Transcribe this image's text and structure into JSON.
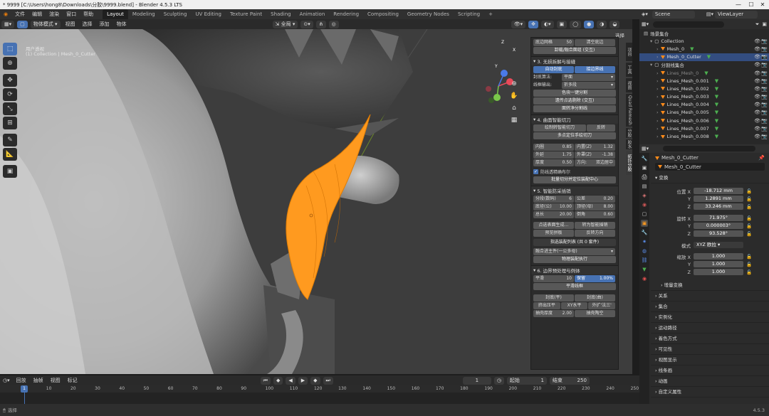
{
  "window": {
    "title": "* 9999 [C:\\Users\\hong8\\Downloads\\分胶\\9999.blend] - Blender 4.5.3 LTS"
  },
  "menu": [
    "文件",
    "编辑",
    "渲染",
    "窗口",
    "帮助"
  ],
  "workspaces": [
    "Layout",
    "Modeling",
    "Sculpting",
    "UV Editing",
    "Texture Paint",
    "Shading",
    "Animation",
    "Rendering",
    "Compositing",
    "Geometry Nodes",
    "Scripting"
  ],
  "add_tab": "+",
  "scene": {
    "label": "Scene",
    "view_layer": "ViewLayer"
  },
  "viewport_header": {
    "mode": "物体模式",
    "items": [
      "视图",
      "选择",
      "添加",
      "物体"
    ],
    "transform_orient": "全局",
    "select_label": "选择"
  },
  "viewport_info": {
    "line1": "用户透视",
    "line2": "(1) Collection | Mesh_0_Cutter"
  },
  "gizmo": {
    "x": "X",
    "y": "Y",
    "z": "Z"
  },
  "side_tabs": [
    "项目",
    "工具",
    "视图",
    "Quad Remesh",
    "分胶",
    "胶水",
    "拓扑分胶"
  ],
  "npanel": {
    "top_row": {
      "label": "底边网格",
      "value": "50",
      "btn": "清空底边"
    },
    "top_btn": "卸载/融合面组 (交互)",
    "s3": {
      "title": "3. 无损拆解与接缝",
      "tab_auto": "自动封底",
      "tab_seam": "接边界线",
      "algo_label": "封底算法:",
      "algo_value": "平面",
      "line_label": "线框输出:",
      "line_value": "折多段",
      "btn1": "色块一键分割",
      "btn2": "遗传点选剔除 (交互)",
      "btn3": "面转净分割线"
    },
    "s4": {
      "title": "4. 曲面智能切刀",
      "btn_a": "绘制转智能切刀",
      "btn_b": "反转",
      "btn_c": "多点定位手绘切刀",
      "f1": {
        "l": "内圈",
        "v": "0.85"
      },
      "f2": {
        "l": "内置(Z)",
        "v": "1.32"
      },
      "f3": {
        "l": "外延",
        "v": "1.75"
      },
      "f4": {
        "l": "外罩(Z)",
        "v": "-1.38"
      },
      "f5": {
        "l": "厚度",
        "v": "0.50"
      },
      "f6": {
        "l": "方向:",
        "v": "双边居中"
      },
      "check": "防线透精确布尔",
      "btn_d": "批量切分并定位装配中心"
    },
    "s5": {
      "title": "5. 智能防采插销",
      "f1": {
        "l": "分段(数码)",
        "v": "6"
      },
      "f2": {
        "l": "公差",
        "v": "0.20"
      },
      "f3": {
        "l": "底径(公)",
        "v": "10.00"
      },
      "f4": {
        "l": "顶径(母)",
        "v": "8.00"
      },
      "f5": {
        "l": "总长",
        "v": "20.00"
      },
      "f6": {
        "l": "倒角",
        "v": "0.60"
      },
      "btn_a": "点选表面生成…",
      "btn_b": "转为智能插销",
      "btn_c": "预览拼板",
      "btn_d": "反转方向",
      "list": "指选装配列表 (共 0 套件)",
      "dropdown": "融合进主件(一公多母)",
      "btn_e": "物理装配执行"
    },
    "s6": {
      "title": "6. 边界预处理与例体",
      "f1": {
        "l": "平滑",
        "v": "10"
      },
      "tab": "保留",
      "pct": "1.00%",
      "btn_a": "平滑线框",
      "opt_a": "封底(平)",
      "opt_b": "封底(曲)",
      "extrude_l": "挤出压平",
      "extrude_v": "XY水平",
      "extrude_r": "外扩'法三'",
      "thick_l": "抽壳厚度",
      "thick_v": "2.00",
      "btn_b": "抽壳陶空"
    }
  },
  "outliner": {
    "root": "场景集合",
    "items": [
      {
        "name": "Collection",
        "indent": 1,
        "type": "coll"
      },
      {
        "name": "Mesh_0",
        "indent": 2,
        "type": "mesh"
      },
      {
        "name": "Mesh_0_Cutter",
        "indent": 2,
        "type": "mesh",
        "selected": true
      },
      {
        "name": "分割线集合",
        "indent": 1,
        "type": "coll"
      },
      {
        "name": "Lines_Mesh_0",
        "indent": 2,
        "type": "mesh",
        "dim": true
      },
      {
        "name": "Lines_Mesh_0.001",
        "indent": 2,
        "type": "mesh"
      },
      {
        "name": "Lines_Mesh_0.002",
        "indent": 2,
        "type": "mesh"
      },
      {
        "name": "Lines_Mesh_0.003",
        "indent": 2,
        "type": "mesh"
      },
      {
        "name": "Lines_Mesh_0.004",
        "indent": 2,
        "type": "mesh"
      },
      {
        "name": "Lines_Mesh_0.005",
        "indent": 2,
        "type": "mesh"
      },
      {
        "name": "Lines_Mesh_0.006",
        "indent": 2,
        "type": "mesh"
      },
      {
        "name": "Lines_Mesh_0.007",
        "indent": 2,
        "type": "mesh"
      },
      {
        "name": "Lines_Mesh_0.008",
        "indent": 2,
        "type": "mesh"
      }
    ]
  },
  "props": {
    "object_name": "Mesh_0_Cutter",
    "data_name": "Mesh_0_Cutter",
    "transform_title": "变换",
    "loc_label": "位置 X",
    "loc": [
      "-18.712 mm",
      "1.2891 mm",
      "33.246 mm"
    ],
    "rot_label": "旋转 X",
    "rot": [
      "71.975°",
      "0.000003°",
      "93.528°"
    ],
    "mode_label": "模式",
    "mode_value": "XYZ 欧拉",
    "scale_label": "缩放 X",
    "scale": [
      "1.000",
      "1.000",
      "1.000"
    ],
    "axis_y": "Y",
    "axis_z": "Z",
    "delta": "增量变换",
    "sections": [
      "关系",
      "集合",
      "实例化",
      "运动路径",
      "着色方式",
      "可见性",
      "视图显示",
      "线条画",
      "动画",
      "自定义属性"
    ]
  },
  "timeline": {
    "menu": [
      "回放",
      "抽帧",
      "视图",
      "标记"
    ],
    "current": "1",
    "start_label": "起始",
    "start": "1",
    "end_label": "结束",
    "end": "250",
    "ticks": [
      "1",
      "10",
      "20",
      "30",
      "40",
      "50",
      "60",
      "70",
      "80",
      "90",
      "100",
      "110",
      "120",
      "130",
      "140",
      "150",
      "160",
      "170",
      "180",
      "190",
      "200",
      "210",
      "220",
      "230",
      "240",
      "250"
    ]
  },
  "status": {
    "left": "选择",
    "right": "4.5.3"
  },
  "colors": {
    "accent": "#4772b3",
    "orange": "#ff9a1f",
    "mesh_gray": "#a8a8a8"
  }
}
